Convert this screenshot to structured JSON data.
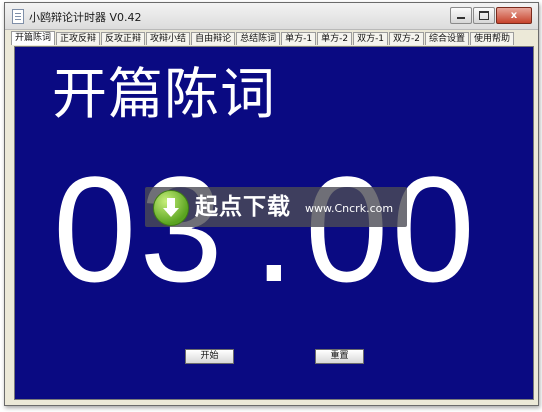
{
  "window": {
    "title": "小鸥辩论计时器 V0.42",
    "minimize_label": "",
    "close_label": "x"
  },
  "tabs": [
    {
      "label": "开篇陈词",
      "active": true
    },
    {
      "label": "正攻反辩",
      "active": false
    },
    {
      "label": "反攻正辩",
      "active": false
    },
    {
      "label": "攻辩小结",
      "active": false
    },
    {
      "label": "自由辩论",
      "active": false
    },
    {
      "label": "总结陈词",
      "active": false
    },
    {
      "label": "单方-1",
      "active": false
    },
    {
      "label": "单方-2",
      "active": false
    },
    {
      "label": "双方-1",
      "active": false
    },
    {
      "label": "双方-2",
      "active": false
    },
    {
      "label": "综合设置",
      "active": false
    },
    {
      "label": "使用帮助",
      "active": false
    }
  ],
  "panel": {
    "phase_title": "开篇陈词",
    "timer": {
      "minutes": "03",
      "separator": ".",
      "seconds": "00"
    },
    "start_label": "开始",
    "reset_label": "重置"
  },
  "watermark": {
    "brand": "起点下载",
    "url": "www.Cncrk.com"
  },
  "colors": {
    "panel_background": "#0a0a82",
    "timer_text": "#ffffff"
  }
}
